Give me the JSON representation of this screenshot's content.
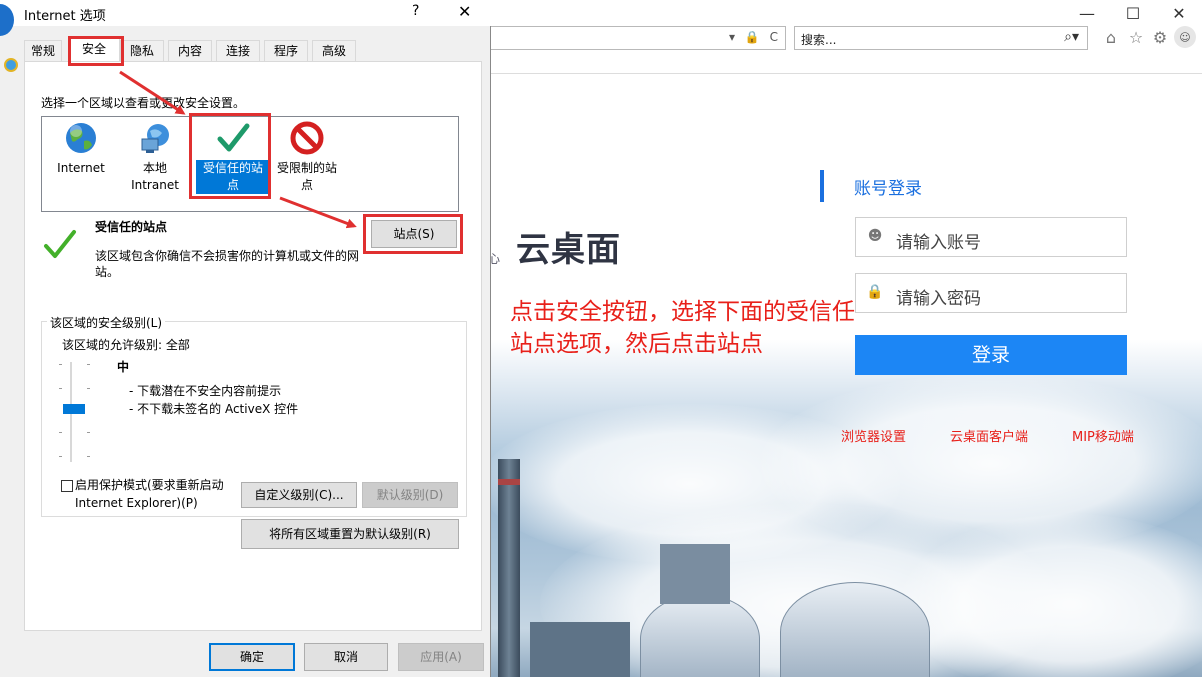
{
  "browser": {
    "window_controls": {
      "minimize": "—",
      "maximize": "☐",
      "close": "✕"
    },
    "address_controls": "▾ 🔒 C",
    "search_placeholder": "搜索...",
    "search_icon": "search-icon"
  },
  "page": {
    "logo_text": "云桌面",
    "logo_mark": "心",
    "annotation": "点击安全按钮，选择下面的受信任站点选项，然后点击站点",
    "login": {
      "title": "账号登录",
      "account_placeholder": "请输入账号",
      "password_placeholder": "请输入密码",
      "button": "登录"
    },
    "links": [
      "浏览器设置",
      "云桌面客户端",
      "MIP移动端"
    ]
  },
  "dialog": {
    "title": "Internet 选项",
    "help": "?",
    "close": "✕",
    "tabs": [
      "常规",
      "安全",
      "隐私",
      "内容",
      "连接",
      "程序",
      "高级"
    ],
    "active_tab": "安全",
    "zone_prompt": "选择一个区域以查看或更改安全设置。",
    "zones": [
      {
        "label": "Internet",
        "icon": "globe-icon"
      },
      {
        "label": "本地\nIntranet",
        "icon": "intranet-icon"
      },
      {
        "label": "受信任的站\n点",
        "icon": "checkmark-icon",
        "selected": true
      },
      {
        "label": "受限制的站\n点",
        "icon": "no-entry-icon"
      }
    ],
    "zone_description": {
      "title": "受信任的站点",
      "text": "该区域包含你确信不会损害你的计算机或文件的网站。"
    },
    "sites_button": "站点(S)",
    "security_level": {
      "legend": "该区域的安全级别(L)",
      "allowed": "该区域的允许级别: 全部",
      "level": "中",
      "level_fraction": 0.5,
      "bullets": [
        "- 下载潜在不安全内容前提示",
        "- 不下载未签名的 ActiveX 控件"
      ],
      "protected_mode": "启用保护模式(要求重新启动 Internet Explorer)(P)",
      "custom_button": "自定义级别(C)...",
      "default_button": "默认级别(D)"
    },
    "reset_all_button": "将所有区域重置为默认级别(R)",
    "ok_button": "确定",
    "cancel_button": "取消",
    "apply_button": "应用(A)"
  },
  "colors": {
    "annotation_red": "#e8201a",
    "accent_blue": "#1a6fdf",
    "selection_blue": "#0078d7"
  }
}
